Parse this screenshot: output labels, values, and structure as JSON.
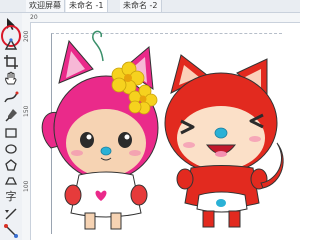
{
  "tabs": [
    {
      "label": "欢迎屏幕"
    },
    {
      "label": "未命名 -1"
    },
    {
      "label": "未命名 -2"
    }
  ],
  "rulers": {
    "top_labels": [
      "20"
    ],
    "left_labels": [
      "200",
      "150",
      "100"
    ]
  },
  "toolbox": {
    "selected_tool": "pick-tool",
    "text_tool_glyph": "字"
  },
  "colors": {
    "highlight": "#d9192a",
    "pink_character": "#ea2a8a",
    "red_character": "#e22a1f",
    "flower": "#f6d21e"
  }
}
